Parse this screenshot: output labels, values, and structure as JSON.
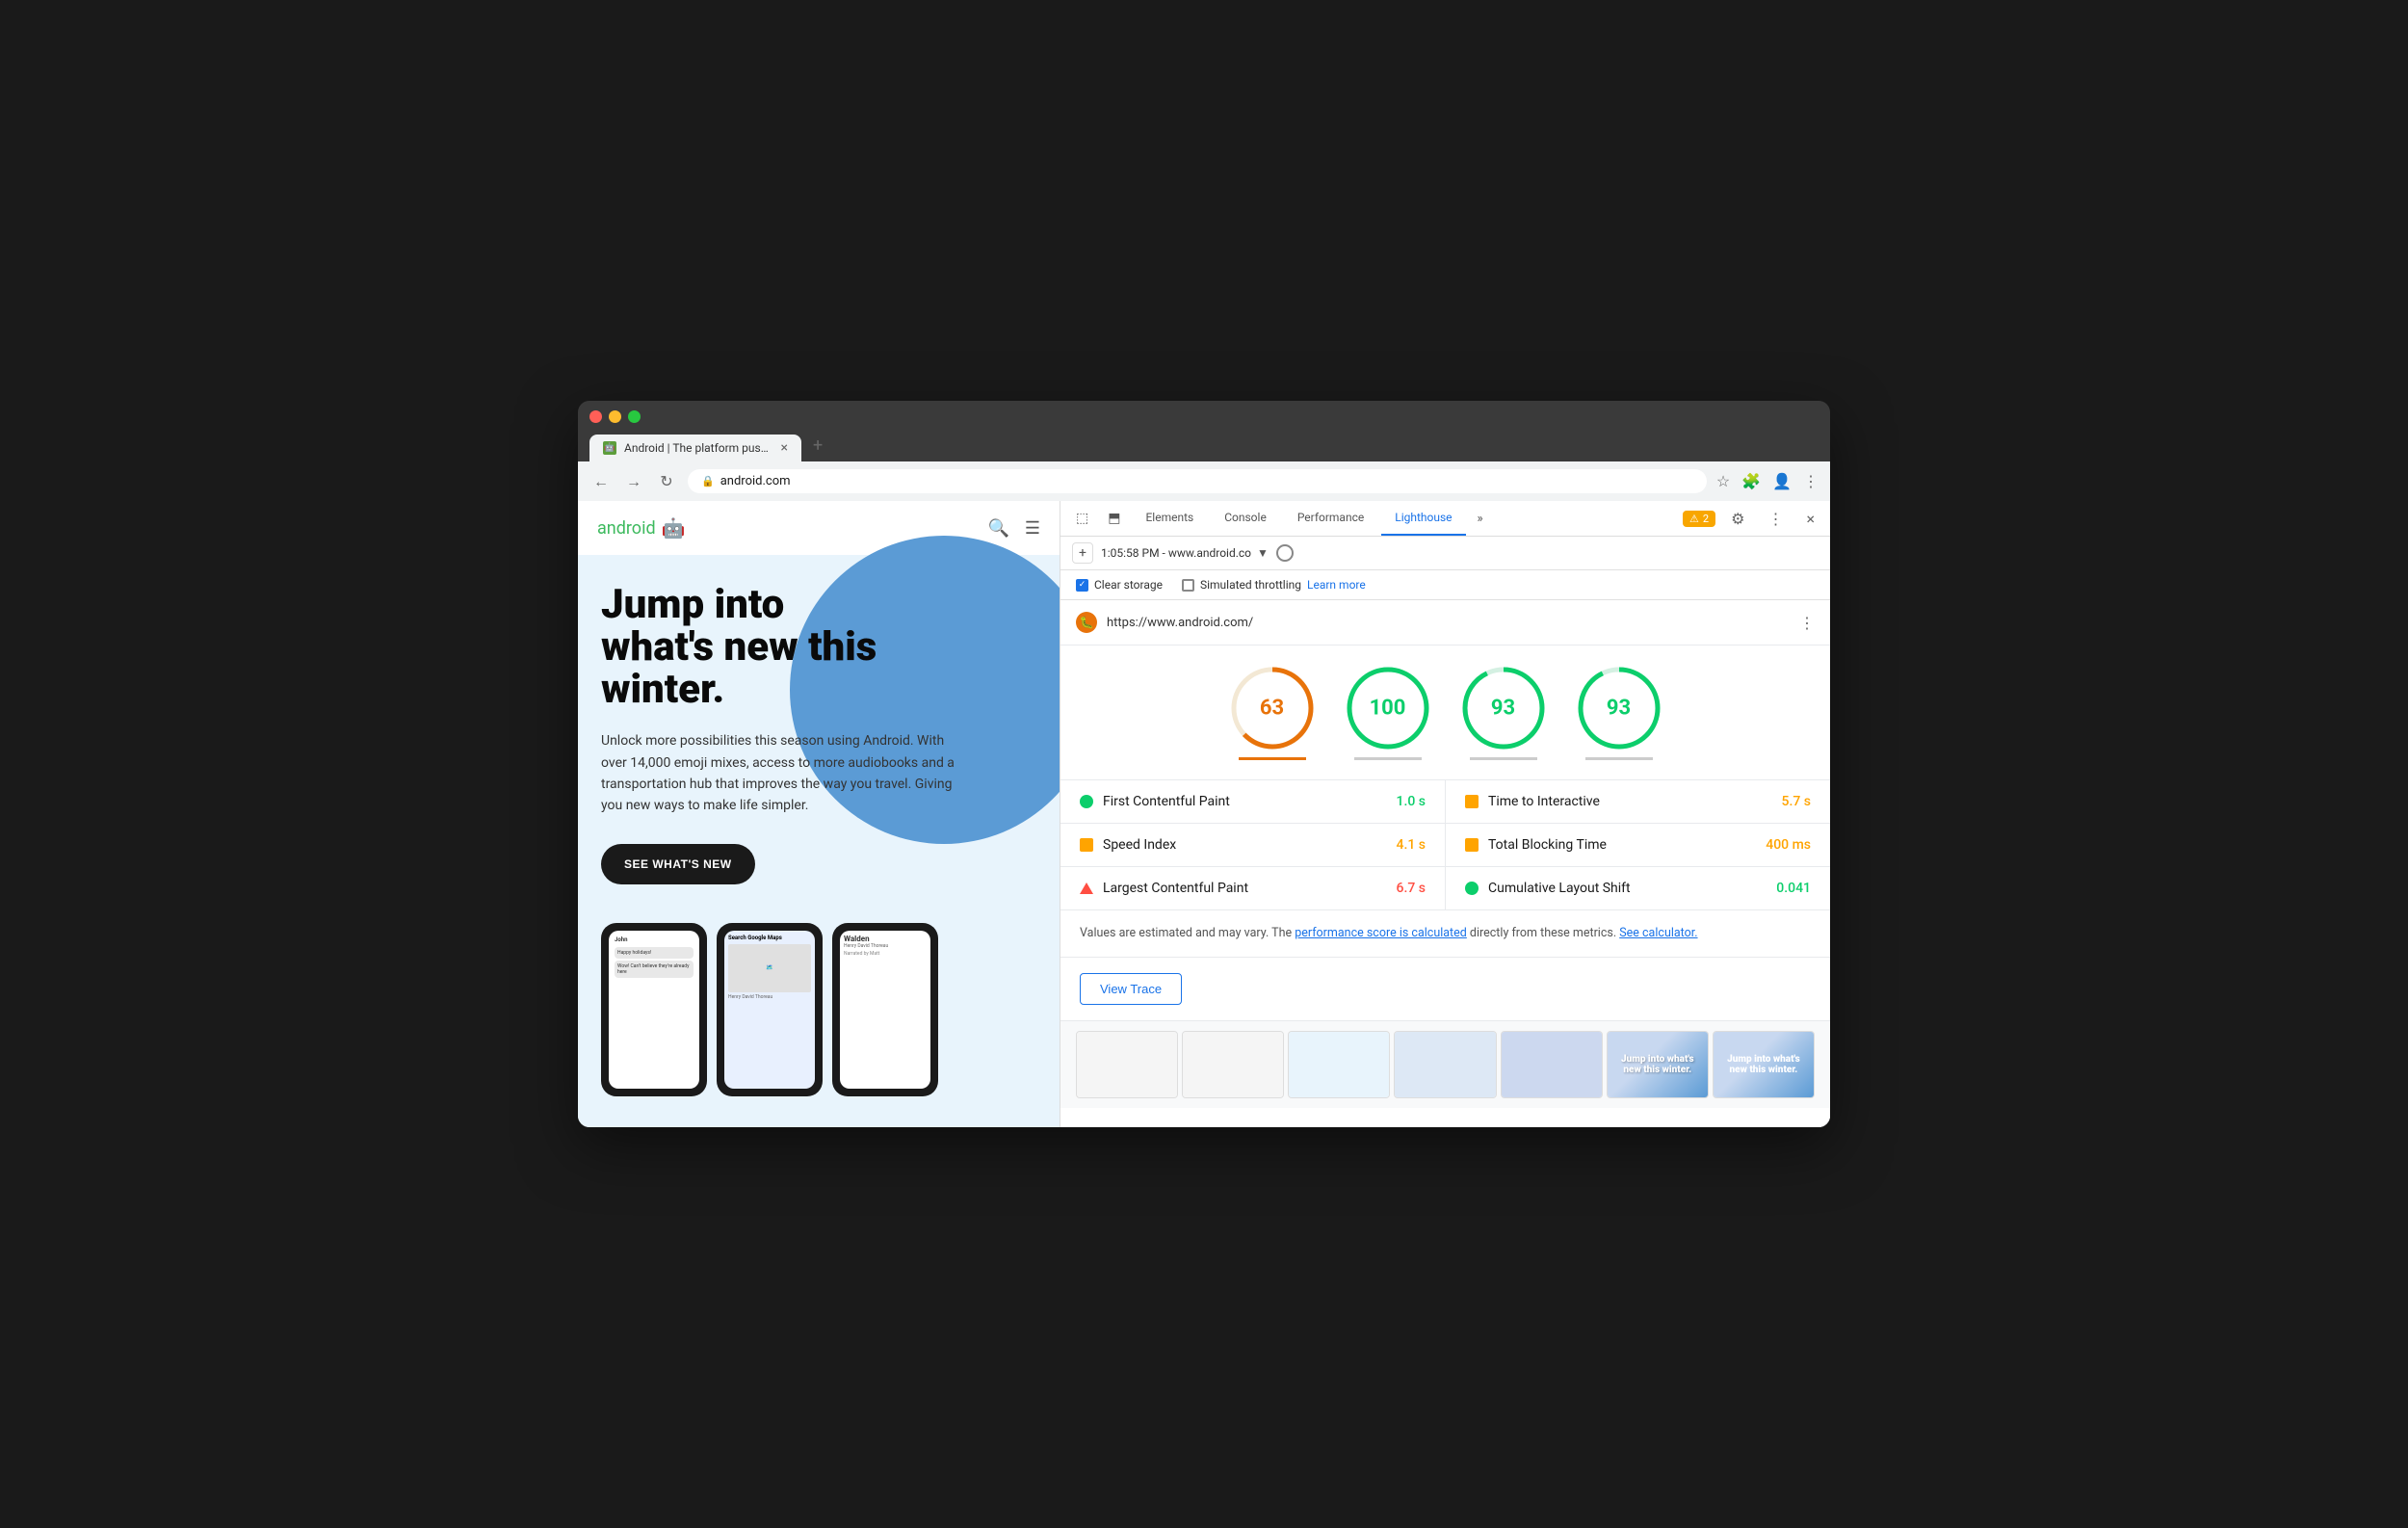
{
  "browser": {
    "tab_favicon": "🤖",
    "tab_title": "Android | The platform pushing...",
    "tab_close": "×",
    "tab_new": "+",
    "address": "android.com",
    "nav_back": "←",
    "nav_forward": "→",
    "nav_refresh": "↻",
    "lock_icon": "🔒",
    "address_full": "android.com"
  },
  "website": {
    "logo_text": "android",
    "mascot": "🤖",
    "headline_line1": "Jump into",
    "headline_line2": "what's new this",
    "headline_line3": "winter.",
    "subtext": "Unlock more possibilities this season using Android. With over 14,000 emoji mixes, access to more audiobooks and a transportation hub that improves the way you travel. Giving you new ways to make life simpler.",
    "cta": "SEE WHAT'S NEW"
  },
  "devtools": {
    "panel_icon_1": "⬚",
    "panel_icon_2": "⬒",
    "tabs": [
      "Elements",
      "Console",
      "Performance",
      "Lighthouse"
    ],
    "active_tab": "Lighthouse",
    "more_tabs": "»",
    "warning_count": "2",
    "settings_icon": "⚙",
    "more_icon": "⋮",
    "close_icon": "×"
  },
  "lighthouse": {
    "toolbar_add": "+",
    "timestamp": "1:05:58 PM - www.android.co",
    "stop_icon": "○",
    "url": "https://www.android.com/",
    "kebab": "⋮",
    "clear_storage_label": "Clear storage",
    "simulated_throttling_label": "Simulated throttling",
    "learn_more": "Learn more",
    "scores": [
      {
        "value": "63",
        "color": "#e8730a",
        "stroke_color": "#e8730a",
        "active": true
      },
      {
        "value": "100",
        "color": "#0cce6b",
        "stroke_color": "#0cce6b",
        "active": false
      },
      {
        "value": "93",
        "color": "#0cce6b",
        "stroke_color": "#0cce6b",
        "active": false
      },
      {
        "value": "93",
        "color": "#0cce6b",
        "stroke_color": "#0cce6b",
        "active": false
      }
    ],
    "metrics": [
      {
        "left": {
          "name": "First Contentful Paint",
          "value": "1.0 s",
          "value_color": "green",
          "indicator": "green"
        },
        "right": {
          "name": "Time to Interactive",
          "value": "5.7 s",
          "value_color": "orange",
          "indicator": "orange"
        }
      },
      {
        "left": {
          "name": "Speed Index",
          "value": "4.1 s",
          "value_color": "orange",
          "indicator": "orange"
        },
        "right": {
          "name": "Total Blocking Time",
          "value": "400 ms",
          "value_color": "orange",
          "indicator": "orange"
        }
      },
      {
        "left": {
          "name": "Largest Contentful Paint",
          "value": "6.7 s",
          "value_color": "red",
          "indicator": "red-triangle"
        },
        "right": {
          "name": "Cumulative Layout Shift",
          "value": "0.041",
          "value_color": "green",
          "indicator": "green"
        }
      }
    ],
    "info_text_1": "Values are estimated and may vary. The ",
    "info_link_1": "performance score is calculated",
    "info_text_2": " directly from these metrics. ",
    "info_link_2": "See calculator.",
    "view_trace_label": "View Trace"
  }
}
